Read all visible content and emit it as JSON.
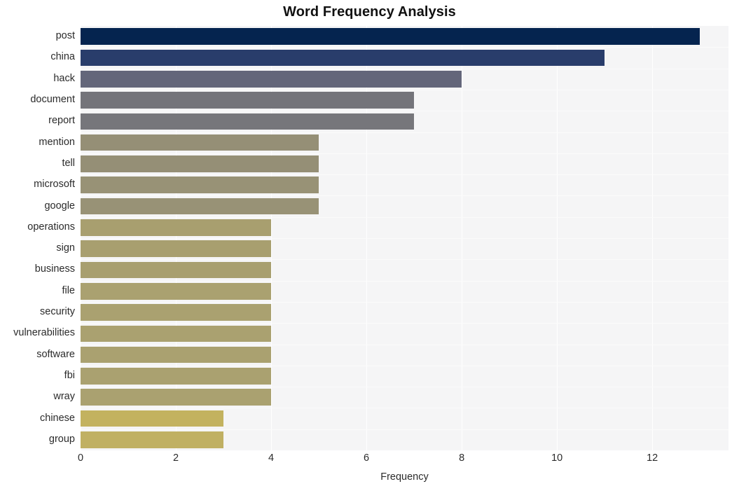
{
  "chart_data": {
    "type": "bar",
    "orientation": "horizontal",
    "title": "Word Frequency Analysis",
    "xlabel": "Frequency",
    "ylabel": "",
    "categories": [
      "post",
      "china",
      "hack",
      "document",
      "report",
      "mention",
      "tell",
      "microsoft",
      "google",
      "operations",
      "sign",
      "business",
      "file",
      "security",
      "vulnerabilities",
      "software",
      "fbi",
      "wray",
      "chinese",
      "group"
    ],
    "values": [
      13,
      11,
      8,
      7,
      7,
      5,
      5,
      5,
      5,
      4,
      4,
      4,
      4,
      4,
      4,
      4,
      4,
      4,
      3,
      3
    ],
    "bar_colors": [
      "#05244f",
      "#293d6b",
      "#63667a",
      "#74747a",
      "#76767b",
      "#958f76",
      "#958f76",
      "#989276",
      "#989276",
      "#a89f6f",
      "#a89f6f",
      "#a89f6f",
      "#aaa170",
      "#aaa170",
      "#aaa170",
      "#aaa170",
      "#aaa170",
      "#aaa170",
      "#c3b25f",
      "#c0b063"
    ],
    "xlim": [
      0,
      13.6
    ],
    "ylim_categories": 20,
    "xticks": [
      0,
      2,
      4,
      6,
      8,
      10,
      12
    ],
    "xticklabels": [
      "0",
      "2",
      "4",
      "6",
      "8",
      "10",
      "12"
    ],
    "grid": true,
    "grid_axis": "x",
    "legend": false,
    "plot_background": "#f5f5f6",
    "figure_background": "#ffffff",
    "gridline_color": "#ffffff",
    "title_color": "#111111",
    "tick_label_color": "#2b2b2b"
  }
}
